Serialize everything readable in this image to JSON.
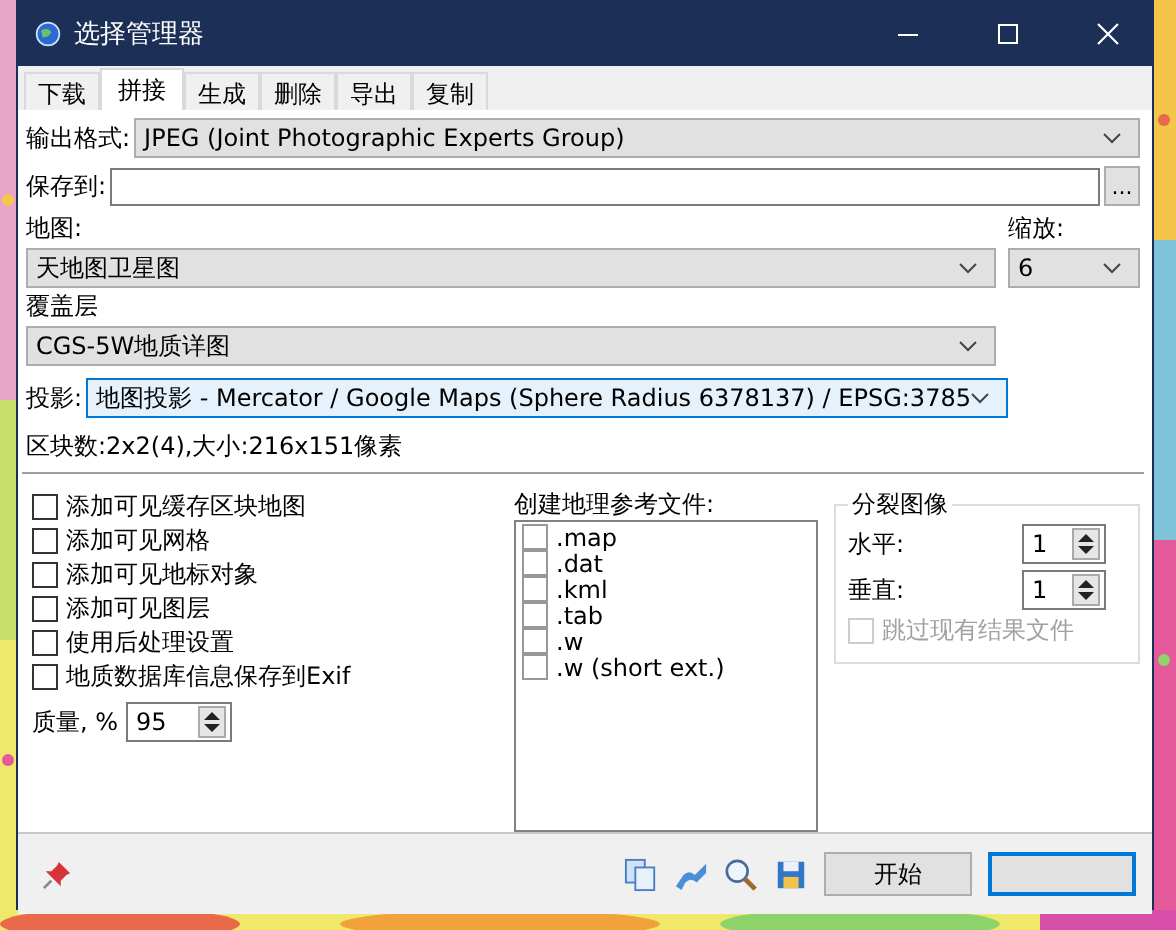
{
  "window": {
    "title": "选择管理器"
  },
  "tabs": [
    {
      "label": "下载",
      "selected": false
    },
    {
      "label": "拼接",
      "selected": true
    },
    {
      "label": "生成",
      "selected": false
    },
    {
      "label": "删除",
      "selected": false
    },
    {
      "label": "导出",
      "selected": false
    },
    {
      "label": "复制",
      "selected": false
    }
  ],
  "output_format": {
    "label": "输出格式:",
    "value": "JPEG (Joint Photographic Experts Group)"
  },
  "save_to": {
    "label": "保存到:",
    "button": "..."
  },
  "map": {
    "label": "地图:",
    "value": "天地图卫星图"
  },
  "zoom": {
    "label": "缩放:",
    "value": "6"
  },
  "overlay": {
    "label": "覆盖层",
    "value": "CGS-5W地质详图"
  },
  "projection": {
    "label": "投影:",
    "value": "地图投影 - Mercator / Google Maps (Sphere Radius 6378137) / EPSG:3785",
    "focused": true
  },
  "tile_info": "区块数:2x2(4),大小:216x151像素",
  "options": [
    {
      "label": "添加可见缓存区块地图",
      "checked": false
    },
    {
      "label": "添加可见网格",
      "checked": false
    },
    {
      "label": "添加可见地标对象",
      "checked": false
    },
    {
      "label": "添加可见图层",
      "checked": false
    },
    {
      "label": "使用后处理设置",
      "checked": false
    },
    {
      "label": "地质数据库信息保存到Exif",
      "checked": false
    }
  ],
  "quality": {
    "label": "质量, %",
    "value": "95"
  },
  "georef": {
    "label": "创建地理参考文件:",
    "files": [
      {
        "label": ".map",
        "checked": false
      },
      {
        "label": ".dat",
        "checked": false
      },
      {
        "label": ".kml",
        "checked": false
      },
      {
        "label": ".tab",
        "checked": false
      },
      {
        "label": ".w",
        "checked": false
      },
      {
        "label": ".w (short ext.)",
        "checked": false
      }
    ]
  },
  "split": {
    "title": "分裂图像",
    "horizontal": {
      "label": "水平:",
      "value": "1"
    },
    "vertical": {
      "label": "垂直:",
      "value": "1"
    },
    "skip": {
      "label": "跳过现有结果文件",
      "checked": false,
      "disabled": true
    }
  },
  "buttons": [
    {
      "label": "开始",
      "focused": false
    },
    {
      "focused": true
    }
  ]
}
